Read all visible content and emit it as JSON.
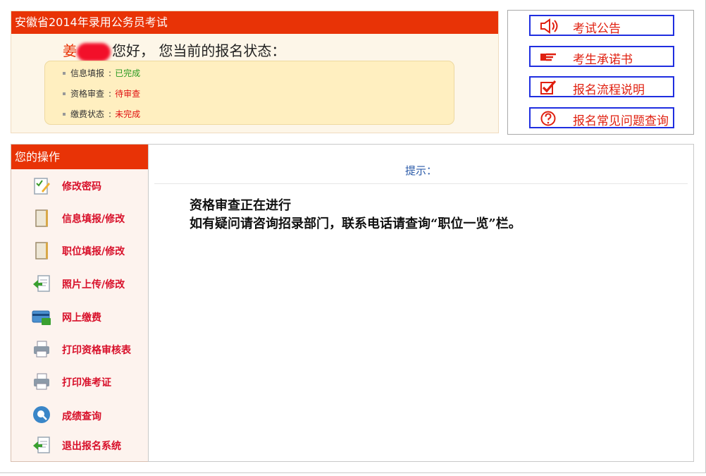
{
  "status": {
    "header": "安徽省2014年录用公务员考试",
    "greeting_surname": "姜",
    "greeting_text": "您好， 您当前的报名状态：",
    "rows": [
      {
        "label": "信息填报",
        "value": "已完成",
        "color": "#2a9a22"
      },
      {
        "label": "资格审查",
        "value": "待审查",
        "color": "#e01010"
      },
      {
        "label": "缴费状态",
        "value": "未完成",
        "color": "#e01010"
      }
    ]
  },
  "quick_links": [
    {
      "label": "考试公告",
      "icon": "speaker-icon"
    },
    {
      "label": "考生承诺书",
      "icon": "pointing-hand-icon"
    },
    {
      "label": "报名流程说明",
      "icon": "checkbox-icon"
    },
    {
      "label": "报名常见问题查询",
      "icon": "question-icon"
    }
  ],
  "sidebar": {
    "title": "您的操作",
    "items": [
      {
        "label": "修改密码",
        "icon": "edit-document-icon"
      },
      {
        "label": "信息填报/修改",
        "icon": "notebook-icon"
      },
      {
        "label": "职位填报/修改",
        "icon": "notebook-icon"
      },
      {
        "label": "照片上传/修改",
        "icon": "upload-document-icon"
      },
      {
        "label": "网上缴费",
        "icon": "payment-card-icon"
      },
      {
        "label": "打印资格审核表",
        "icon": "printer-icon"
      },
      {
        "label": "打印准考证",
        "icon": "printer-icon"
      },
      {
        "label": "成绩查询",
        "icon": "search-icon"
      },
      {
        "label": "退出报名系统",
        "icon": "exit-document-icon"
      }
    ]
  },
  "main": {
    "hint_title": "提示：",
    "notice_lines": [
      "资格审查正在进行",
      "如有疑问请咨询招录部门，联系电话请查询“职位一览”栏。"
    ]
  },
  "colors": {
    "accent_red": "#e83306",
    "link_border_blue": "#1f2ee0",
    "link_text_red": "#e02010",
    "hint_blue": "#2a5aa8"
  }
}
